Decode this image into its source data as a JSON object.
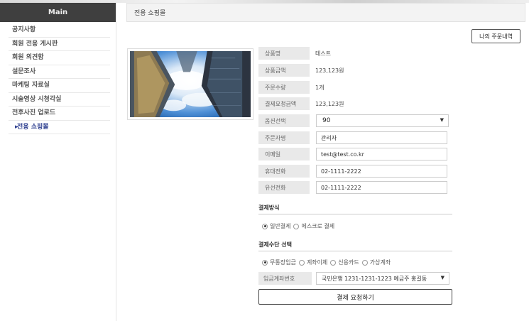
{
  "sidebar": {
    "header": "Main",
    "items": [
      {
        "label": "공지사항"
      },
      {
        "label": "회원 전용 게시판"
      },
      {
        "label": "회원 의견함"
      },
      {
        "label": "설문조사"
      },
      {
        "label": "마케팅 자료실"
      },
      {
        "label": "시술영상 시청각실"
      },
      {
        "label": "전후사진 업로드"
      },
      {
        "label": "전용 쇼핑몰",
        "active": true
      }
    ]
  },
  "page": {
    "title": "전용 쇼핑몰",
    "history_button": "나의 주문내역"
  },
  "product": {
    "image_icon": "skyscraper-photo",
    "rows": [
      {
        "label": "상품명",
        "value": "테스트"
      },
      {
        "label": "상품금액",
        "value": "123,123원"
      },
      {
        "label": "주문수량",
        "value": "1개"
      },
      {
        "label": "결제요청금액",
        "value": "123,123원"
      }
    ],
    "option": {
      "label": "옵션선택",
      "value": "90"
    }
  },
  "order_form": {
    "orderer": {
      "label": "주문자명",
      "value": "관리자"
    },
    "email": {
      "label": "이메일",
      "value": "test@test.co.kr"
    },
    "mobile": {
      "label": "휴대전화",
      "value": "02-1111-2222"
    },
    "phone": {
      "label": "유선전화",
      "value": "02-1111-2222"
    }
  },
  "payment": {
    "method_title": "결제방식",
    "methods": [
      {
        "label": "일반결제",
        "selected": true
      },
      {
        "label": "에스크로 결제",
        "selected": false
      }
    ],
    "means_title": "결제수단 선택",
    "means": [
      {
        "label": "무통장입금",
        "selected": true
      },
      {
        "label": "계좌이체",
        "selected": false
      },
      {
        "label": "신용카드",
        "selected": false
      },
      {
        "label": "가상계좌",
        "selected": false
      }
    ],
    "account_label": "입금계좌번호",
    "account_value": "국민은행 1231-1231-1223 예금주 홍길동",
    "submit": "결제 요청하기"
  }
}
